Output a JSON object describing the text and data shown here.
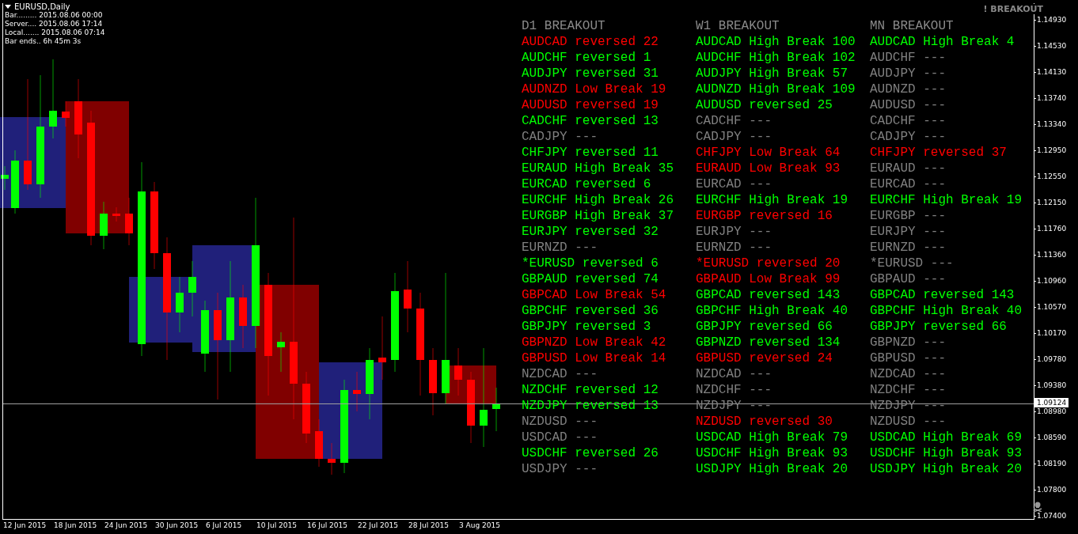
{
  "chart": {
    "symbol": "EURUSD,Daily",
    "info": [
      "Bar......... 2015.08.06 00:00",
      "Server.... 2015.08.06 17:14",
      "Local....... 2015.08.06 07:14",
      "Bar ends.. 6h 45m 3s"
    ],
    "indicator_label": "! BREAKOUT",
    "price_labels": [
      "1.14930",
      "1.14530",
      "1.14130",
      "1.13740",
      "1.13340",
      "1.12950",
      "1.12550",
      "1.12150",
      "1.11760",
      "1.11360",
      "1.10960",
      "1.10570",
      "1.10170",
      "1.09780",
      "1.09380",
      "1.08980",
      "1.08590",
      "1.08190",
      "1.07800",
      "1.07400"
    ],
    "current_price": "1.09124",
    "dates": [
      "12 Jun 2015",
      "18 Jun 2015",
      "24 Jun 2015",
      "30 Jun 2015",
      "6 Jul 2015",
      "10 Jul 2015",
      "16 Jul 2015",
      "22 Jul 2015",
      "28 Jul 2015",
      "3 Aug 2015"
    ]
  },
  "breakout_table": {
    "columns": [
      {
        "header": "D1 BREAKOUT",
        "rows": [
          {
            "text": "AUDCAD reversed 22",
            "color": "#ff0000"
          },
          {
            "text": "AUDCHF reversed 1",
            "color": "#00ff00"
          },
          {
            "text": "AUDJPY reversed 31",
            "color": "#00ff00"
          },
          {
            "text": "AUDNZD Low Break 19",
            "color": "#ff0000"
          },
          {
            "text": "AUDUSD reversed 19",
            "color": "#ff0000"
          },
          {
            "text": "CADCHF reversed 13",
            "color": "#00ff00"
          },
          {
            "text": "CADJPY ---",
            "color": "#808080"
          },
          {
            "text": "CHFJPY reversed 11",
            "color": "#00ff00"
          },
          {
            "text": "EURAUD High Break 35",
            "color": "#00ff00"
          },
          {
            "text": "EURCAD reversed 6",
            "color": "#00ff00"
          },
          {
            "text": "EURCHF High Break 26",
            "color": "#00ff00"
          },
          {
            "text": "EURGBP High Break 37",
            "color": "#00ff00"
          },
          {
            "text": "EURJPY reversed 32",
            "color": "#00ff00"
          },
          {
            "text": "EURNZD ---",
            "color": "#808080"
          },
          {
            "text": "*EURUSD reversed 6",
            "color": "#00ff00"
          },
          {
            "text": "GBPAUD reversed 74",
            "color": "#00ff00"
          },
          {
            "text": "GBPCAD Low Break 54",
            "color": "#ff0000"
          },
          {
            "text": "GBPCHF reversed 36",
            "color": "#00ff00"
          },
          {
            "text": "GBPJPY reversed 3",
            "color": "#00ff00"
          },
          {
            "text": "GBPNZD Low Break 42",
            "color": "#ff0000"
          },
          {
            "text": "GBPUSD Low Break 14",
            "color": "#ff0000"
          },
          {
            "text": "NZDCAD ---",
            "color": "#808080"
          },
          {
            "text": "NZDCHF reversed 12",
            "color": "#00ff00"
          },
          {
            "text": "NZDJPY reversed 13",
            "color": "#00ff00"
          },
          {
            "text": "NZDUSD ---",
            "color": "#808080"
          },
          {
            "text": "USDCAD ---",
            "color": "#808080"
          },
          {
            "text": "USDCHF reversed 26",
            "color": "#00ff00"
          },
          {
            "text": "USDJPY ---",
            "color": "#808080"
          }
        ]
      },
      {
        "header": "W1 BREAKOUT",
        "rows": [
          {
            "text": "AUDCAD High Break 100",
            "color": "#00ff00"
          },
          {
            "text": "AUDCHF High Break 102",
            "color": "#00ff00"
          },
          {
            "text": "AUDJPY High Break 57",
            "color": "#00ff00"
          },
          {
            "text": "AUDNZD High Break 109",
            "color": "#00ff00"
          },
          {
            "text": "AUDUSD reversed 25",
            "color": "#00ff00"
          },
          {
            "text": "CADCHF ---",
            "color": "#808080"
          },
          {
            "text": "CADJPY ---",
            "color": "#808080"
          },
          {
            "text": "CHFJPY Low Break 64",
            "color": "#ff0000"
          },
          {
            "text": "EURAUD Low Break 93",
            "color": "#ff0000"
          },
          {
            "text": "EURCAD ---",
            "color": "#808080"
          },
          {
            "text": "EURCHF High Break 19",
            "color": "#00ff00"
          },
          {
            "text": "EURGBP reversed 16",
            "color": "#ff0000"
          },
          {
            "text": "EURJPY ---",
            "color": "#808080"
          },
          {
            "text": "EURNZD ---",
            "color": "#808080"
          },
          {
            "text": "*EURUSD reversed 20",
            "color": "#ff0000"
          },
          {
            "text": "GBPAUD Low Break 99",
            "color": "#ff0000"
          },
          {
            "text": "GBPCAD reversed 143",
            "color": "#00ff00"
          },
          {
            "text": "GBPCHF High Break 40",
            "color": "#00ff00"
          },
          {
            "text": "GBPJPY reversed 66",
            "color": "#00ff00"
          },
          {
            "text": "GBPNZD reversed 134",
            "color": "#00ff00"
          },
          {
            "text": "GBPUSD reversed 24",
            "color": "#ff0000"
          },
          {
            "text": "NZDCAD ---",
            "color": "#808080"
          },
          {
            "text": "NZDCHF ---",
            "color": "#808080"
          },
          {
            "text": "NZDJPY ---",
            "color": "#808080"
          },
          {
            "text": "NZDUSD reversed 30",
            "color": "#ff0000"
          },
          {
            "text": "USDCAD High Break 79",
            "color": "#00ff00"
          },
          {
            "text": "USDCHF High Break 93",
            "color": "#00ff00"
          },
          {
            "text": "USDJPY High Break 20",
            "color": "#00ff00"
          }
        ]
      },
      {
        "header": "MN BREAKOUT",
        "rows": [
          {
            "text": "AUDCAD High Break 4",
            "color": "#00ff00"
          },
          {
            "text": "AUDCHF ---",
            "color": "#808080"
          },
          {
            "text": "AUDJPY ---",
            "color": "#808080"
          },
          {
            "text": "AUDNZD ---",
            "color": "#808080"
          },
          {
            "text": "AUDUSD ---",
            "color": "#808080"
          },
          {
            "text": "CADCHF ---",
            "color": "#808080"
          },
          {
            "text": "CADJPY ---",
            "color": "#808080"
          },
          {
            "text": "CHFJPY reversed 37",
            "color": "#ff0000"
          },
          {
            "text": "EURAUD ---",
            "color": "#808080"
          },
          {
            "text": "EURCAD ---",
            "color": "#808080"
          },
          {
            "text": "EURCHF High Break 19",
            "color": "#00ff00"
          },
          {
            "text": "EURGBP ---",
            "color": "#808080"
          },
          {
            "text": "EURJPY ---",
            "color": "#808080"
          },
          {
            "text": "EURNZD ---",
            "color": "#808080"
          },
          {
            "text": "*EURUSD ---",
            "color": "#808080"
          },
          {
            "text": "GBPAUD ---",
            "color": "#808080"
          },
          {
            "text": "GBPCAD reversed 143",
            "color": "#00ff00"
          },
          {
            "text": "GBPCHF High Break 40",
            "color": "#00ff00"
          },
          {
            "text": "GBPJPY reversed 66",
            "color": "#00ff00"
          },
          {
            "text": "GBPNZD ---",
            "color": "#808080"
          },
          {
            "text": "GBPUSD ---",
            "color": "#808080"
          },
          {
            "text": "NZDCAD ---",
            "color": "#808080"
          },
          {
            "text": "NZDCHF ---",
            "color": "#808080"
          },
          {
            "text": "NZDJPY ---",
            "color": "#808080"
          },
          {
            "text": "NZDUSD ---",
            "color": "#808080"
          },
          {
            "text": "USDCAD High Break 69",
            "color": "#00ff00"
          },
          {
            "text": "USDCHF High Break 93",
            "color": "#00ff00"
          },
          {
            "text": "USDJPY High Break 20",
            "color": "#00ff00"
          }
        ]
      }
    ]
  }
}
